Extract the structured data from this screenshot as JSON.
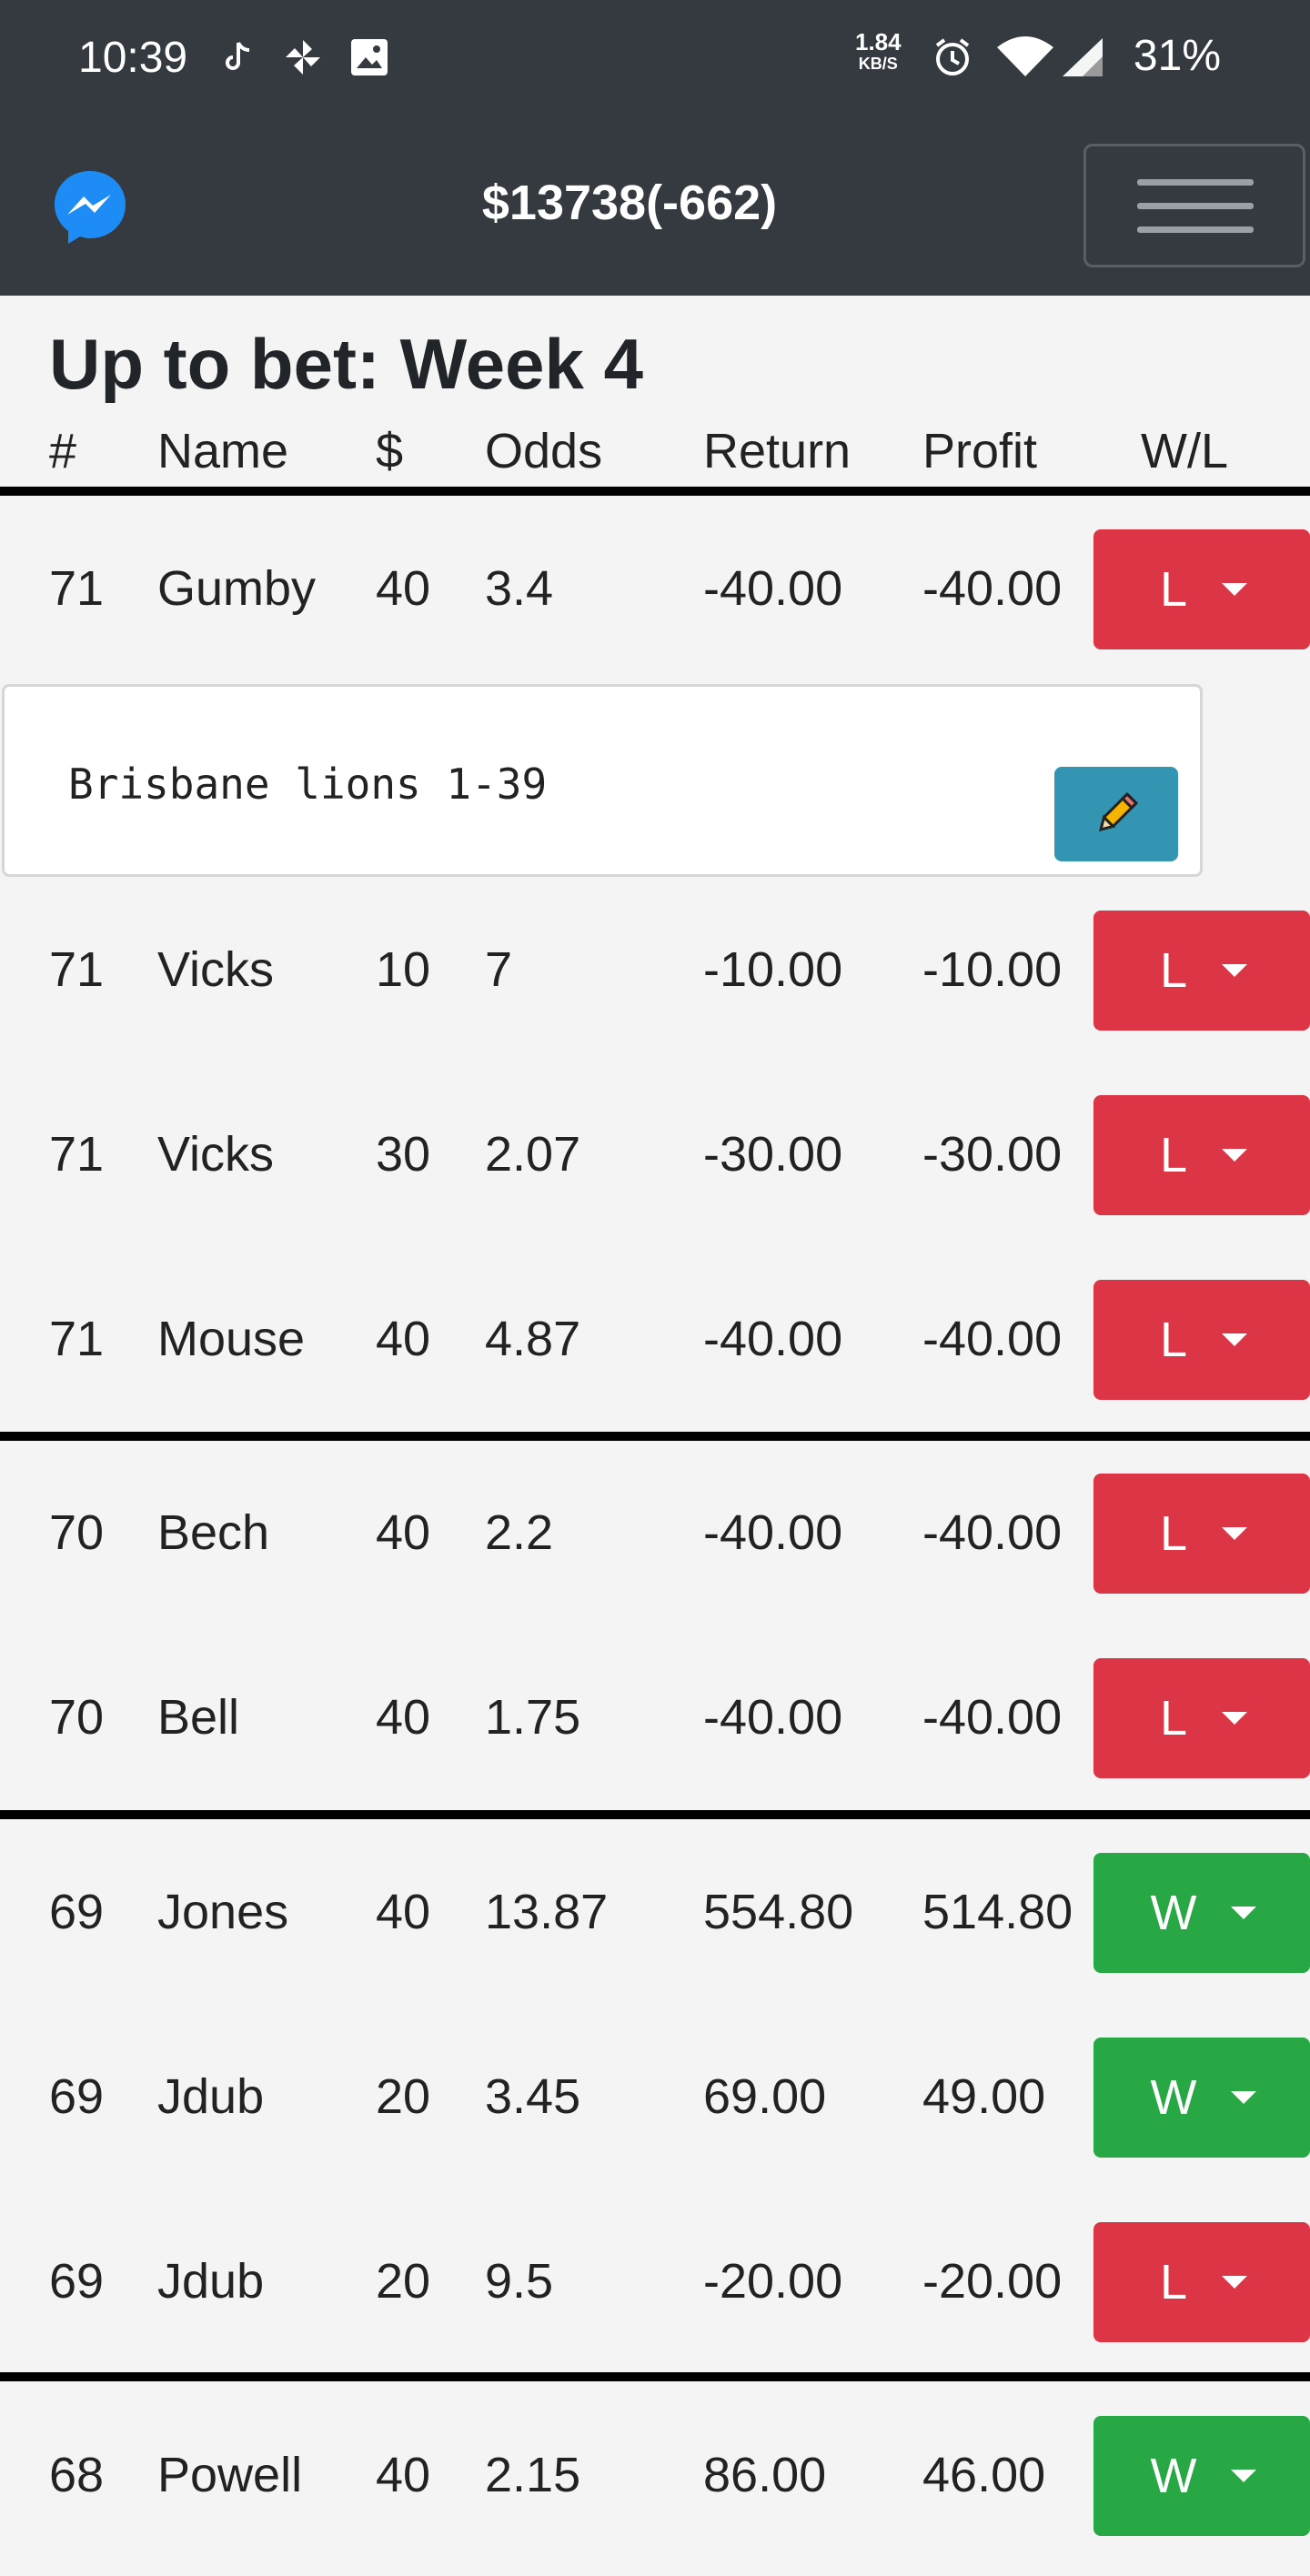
{
  "status_bar": {
    "time": "10:39",
    "net_speed": "1.84",
    "net_unit": "KB/S",
    "battery": "31%"
  },
  "navbar": {
    "balance": "$13738(-662)"
  },
  "page": {
    "title": "Up to bet: Week 4"
  },
  "table": {
    "headers": {
      "num": "#",
      "name": "Name",
      "amount": "$",
      "odds": "Odds",
      "return": "Return",
      "profit": "Profit",
      "wl": "W/L"
    },
    "rows": [
      {
        "num": "71",
        "name": "Gumby",
        "amount": "40",
        "odds": "3.4",
        "return": "-40.00",
        "profit": "-40.00",
        "result": "L"
      },
      {
        "num": "71",
        "name": "Vicks",
        "amount": "10",
        "odds": "7",
        "return": "-10.00",
        "profit": "-10.00",
        "result": "L"
      },
      {
        "num": "71",
        "name": "Vicks",
        "amount": "30",
        "odds": "2.07",
        "return": "-30.00",
        "profit": "-30.00",
        "result": "L"
      },
      {
        "num": "71",
        "name": "Mouse",
        "amount": "40",
        "odds": "4.87",
        "return": "-40.00",
        "profit": "-40.00",
        "result": "L"
      },
      {
        "num": "70",
        "name": "Bech",
        "amount": "40",
        "odds": "2.2",
        "return": "-40.00",
        "profit": "-40.00",
        "result": "L"
      },
      {
        "num": "70",
        "name": "Bell",
        "amount": "40",
        "odds": "1.75",
        "return": "-40.00",
        "profit": "-40.00",
        "result": "L"
      },
      {
        "num": "69",
        "name": "Jones",
        "amount": "40",
        "odds": "13.87",
        "return": "554.80",
        "profit": "514.80",
        "result": "W"
      },
      {
        "num": "69",
        "name": "Jdub",
        "amount": "20",
        "odds": "3.45",
        "return": "69.00",
        "profit": "49.00",
        "result": "W"
      },
      {
        "num": "69",
        "name": "Jdub",
        "amount": "20",
        "odds": "9.5",
        "return": "-20.00",
        "profit": "-20.00",
        "result": "L"
      },
      {
        "num": "68",
        "name": "Powell",
        "amount": "40",
        "odds": "2.15",
        "return": "86.00",
        "profit": "46.00",
        "result": "W"
      }
    ],
    "note": "Brisbane lions 1-39"
  },
  "colors": {
    "navbar": "#343a40",
    "loss": "#dc3545",
    "win": "#28a745",
    "edit": "#3395b2"
  }
}
